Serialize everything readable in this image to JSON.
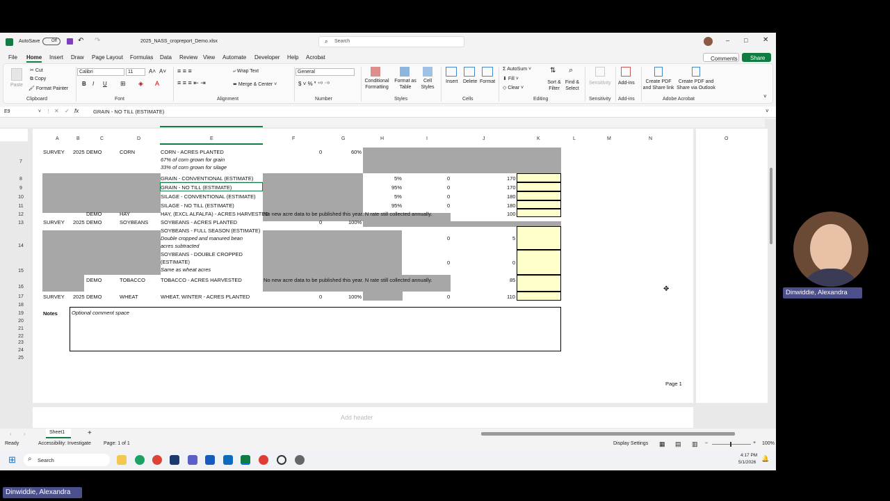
{
  "titlebar": {
    "autosave": "AutoSave",
    "autosave_state": "Off",
    "filename": "2025_NASS_cropreport_Demo.xlsx",
    "search": "Search"
  },
  "tabs": [
    "File",
    "Home",
    "Insert",
    "Draw",
    "Page Layout",
    "Formulas",
    "Data",
    "Review",
    "View",
    "Automate",
    "Developer",
    "Help",
    "Acrobat"
  ],
  "buttons": {
    "comments": "Comments",
    "share": "Share"
  },
  "ribbon": {
    "clipboard": {
      "paste": "Paste",
      "cut": "Cut",
      "copy": "Copy",
      "format_painter": "Format Painter",
      "label": "Clipboard"
    },
    "font": {
      "name": "Calibri",
      "size": "11",
      "label": "Font"
    },
    "alignment": {
      "wrap": "Wrap Text",
      "merge": "Merge & Center",
      "label": "Alignment"
    },
    "number": {
      "format": "General",
      "label": "Number"
    },
    "styles": {
      "conditional": "Conditional Formatting",
      "format_table": "Format as Table",
      "cell_styles": "Cell Styles",
      "label": "Styles"
    },
    "cells": {
      "insert": "Insert",
      "delete": "Delete",
      "format": "Format",
      "label": "Cells"
    },
    "editing": {
      "autosum": "AutoSum",
      "fill": "Fill",
      "clear": "Clear",
      "sort": "Sort & Filter",
      "find": "Find & Select",
      "label": "Editing"
    },
    "sensitivity": {
      "btn": "Sensitivity",
      "label": "Sensitivity"
    },
    "addins": {
      "btn": "Add-ins",
      "label": "Add-ins"
    },
    "acrobat": {
      "b1": "Create PDF and Share link",
      "b2": "Create PDF and Share via Outlook",
      "label": "Adobe Acrobat"
    }
  },
  "formula_bar": {
    "cell_ref": "E9",
    "fx": "fx",
    "value": "GRAIN - NO TILL (ESTIMATE)"
  },
  "columns": [
    "A",
    "B",
    "C",
    "D",
    "E",
    "F",
    "G",
    "H",
    "I",
    "J",
    "K",
    "L",
    "M",
    "N",
    "O"
  ],
  "rows": [
    "7",
    "8",
    "9",
    "10",
    "11",
    "12",
    "13",
    "14",
    "15",
    "16",
    "17",
    "18",
    "19",
    "20",
    "21",
    "22",
    "23",
    "24",
    "25"
  ],
  "cells": {
    "r1": {
      "a": "SURVEY",
      "b": "2025",
      "c": "DEMO",
      "d": "CORN",
      "e": "CORN - ACRES PLANTED",
      "e2": "67% of corn grown for grain",
      "e3": "33% of corn grown for silage",
      "f": "0",
      "g": "60%"
    },
    "r8": {
      "e": "GRAIN - CONVENTIONAL (ESTIMATE)",
      "h": "5%",
      "i": "0",
      "j": "170"
    },
    "r9": {
      "e": "GRAIN - NO TILL (ESTIMATE)",
      "h": "95%",
      "i": "0",
      "j": "170"
    },
    "r10": {
      "e": "SILAGE - CONVENTIONAL (ESTIMATE)",
      "h": "5%",
      "i": "0",
      "j": "180"
    },
    "r11": {
      "e": "SILAGE - NO TILL (ESTIMATE)",
      "h": "95%",
      "i": "0",
      "j": "180"
    },
    "r12": {
      "c": "DEMO",
      "d": "HAY",
      "e": "HAY, (EXCL ALFALFA) - ACRES HARVESTED",
      "note": "No new acre data to be published this year. N rate still collected annually.",
      "j": "100"
    },
    "r13": {
      "a": "SURVEY",
      "b": "2025",
      "c": "DEMO",
      "d": "SOYBEANS",
      "e": "SOYBEANS - ACRES PLANTED",
      "f": "0",
      "g": "100%"
    },
    "r14": {
      "e": "SOYBEANS - FULL SEASON (ESTIMATE)",
      "e2": "Double cropped and manured bean",
      "e3": "acres subtracted",
      "i": "0",
      "j": "5"
    },
    "r15": {
      "e": "SOYBEANS - DOUBLE CROPPED",
      "e1b": "(ESTIMATE)",
      "e2": "Same as wheat acres",
      "i": "0",
      "j": "0"
    },
    "r16": {
      "c": "DEMO",
      "d": "TOBACCO",
      "e": "TOBACCO - ACRES HARVESTED",
      "note": "No new acre data to be published this year. N rate still collected annually.",
      "j": "85"
    },
    "r17": {
      "a": "SURVEY",
      "b": "2025",
      "c": "DEMO",
      "d": "WHEAT",
      "e": "WHEAT, WINTER - ACRES PLANTED",
      "f": "0",
      "g": "100%",
      "i": "0",
      "j": "110"
    },
    "notes": {
      "label": "Notes",
      "placeholder": "Optional comment space"
    }
  },
  "page_label": "Page 1",
  "add_header": "Add header",
  "sheet_tab": "Sheet1",
  "status": {
    "ready": "Ready",
    "accessibility": "Accessibility: Investigate",
    "pages": "Page: 1 of 1",
    "display": "Display Settings",
    "zoom": "100%"
  },
  "taskbar": {
    "search": "Search",
    "time": "4:17 PM",
    "date": "5/1/2026"
  },
  "participant": {
    "name": "Dinwiddie, Alexandra",
    "name_bottom": "Dinwiddie, Alexandra"
  },
  "colors": {
    "excel_green": "#107c41",
    "gray_fill": "#a7a7a7",
    "yellow": "#ffffcc",
    "name_tag": "#4b4f8c"
  }
}
